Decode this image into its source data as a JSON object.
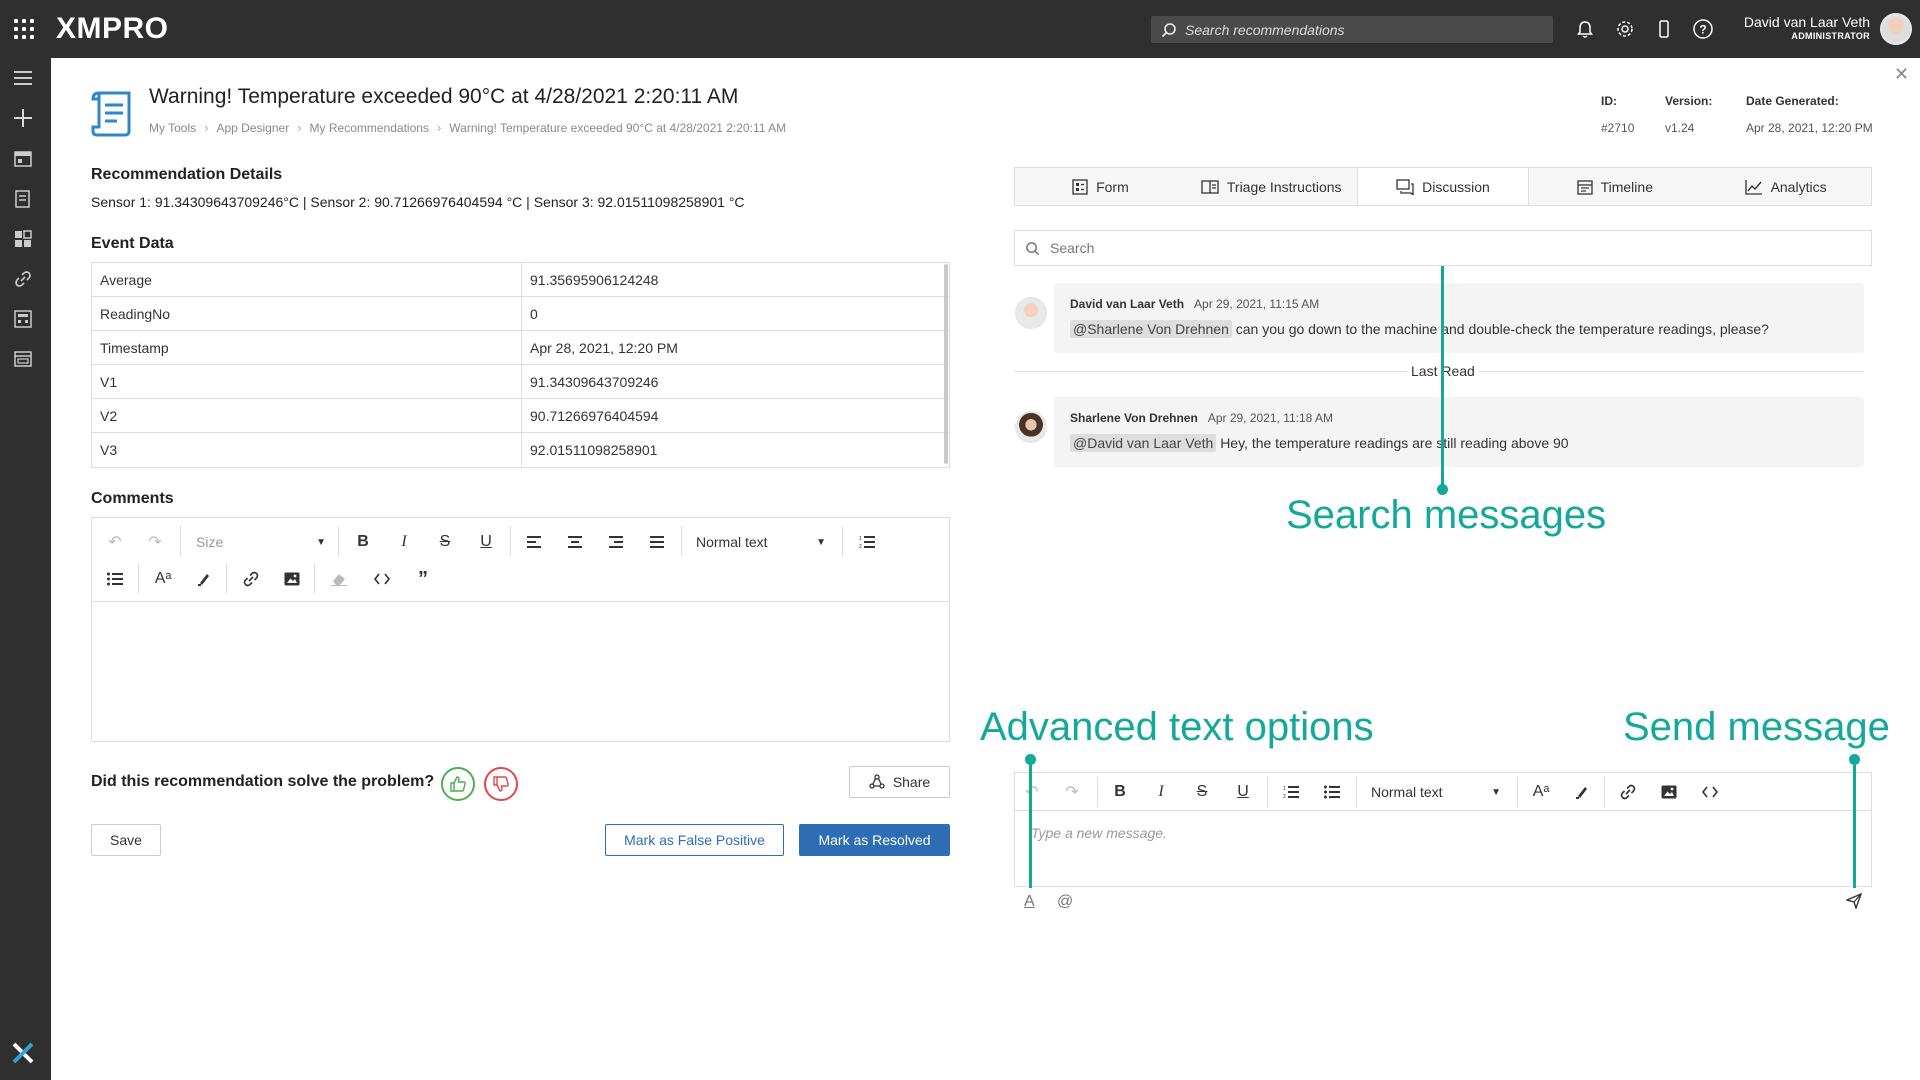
{
  "topbar": {
    "logo": "XMPRO",
    "search_placeholder": "Search recommendations",
    "user_name": "David van Laar Veth",
    "user_role": "ADMINISTRATOR"
  },
  "header": {
    "title": "Warning! Temperature exceeded 90°C at 4/28/2021 2:20:11 AM",
    "breadcrumb": [
      "My Tools",
      "App Designer",
      "My Recommendations",
      "Warning! Temperature exceeded 90°C at 4/28/2021 2:20:11 AM"
    ],
    "id_label": "ID:",
    "id_value": "#2710",
    "version_label": "Version:",
    "version_value": "v1.24",
    "date_label": "Date Generated:",
    "date_value": "Apr 28, 2021, 12:20 PM"
  },
  "details": {
    "title": "Recommendation Details",
    "text": "Sensor 1: 91.34309643709246°C | Sensor 2: 90.71266976404594 °C | Sensor 3: 92.01511098258901 °C"
  },
  "event_data": {
    "title": "Event Data",
    "rows": [
      {
        "key": "Average",
        "value": "91.35695906124248"
      },
      {
        "key": "ReadingNo",
        "value": "0"
      },
      {
        "key": "Timestamp",
        "value": "Apr 28, 2021, 12:20 PM"
      },
      {
        "key": "V1",
        "value": "91.34309643709246"
      },
      {
        "key": "V2",
        "value": "90.71266976404594"
      },
      {
        "key": "V3",
        "value": "92.01511098258901"
      }
    ]
  },
  "comments": {
    "title": "Comments",
    "size_label": "Size",
    "format_label": "Normal text"
  },
  "feedback": {
    "question": "Did this recommendation solve the problem?",
    "share": "Share",
    "save": "Save",
    "false_positive": "Mark as False Positive",
    "resolved": "Mark as Resolved"
  },
  "tabs": [
    "Form",
    "Triage Instructions",
    "Discussion",
    "Timeline",
    "Analytics"
  ],
  "discussion": {
    "search_placeholder": "Search",
    "last_read": "Last Read",
    "messages": [
      {
        "author": "David van Laar Veth",
        "time": "Apr 29, 2021, 11:15 AM",
        "mention": "@Sharlene Von Drehnen",
        "text": "can you go down to the machine and double-check the temperature readings, please?"
      },
      {
        "author": "Sharlene Von Drehnen",
        "time": "Apr 29, 2021, 11:18 AM",
        "mention": "@David van Laar Veth",
        "text": "Hey, the temperature readings are still reading above 90"
      }
    ],
    "new_message_placeholder": "Type a new message.",
    "format_label": "Normal text"
  },
  "annotations": {
    "search": "Search messages",
    "advanced": "Advanced text options",
    "send": "Send message"
  },
  "colors": {
    "accent": "#2d6db4",
    "annotation": "#14a89a",
    "topbar": "#2f2f2f"
  }
}
